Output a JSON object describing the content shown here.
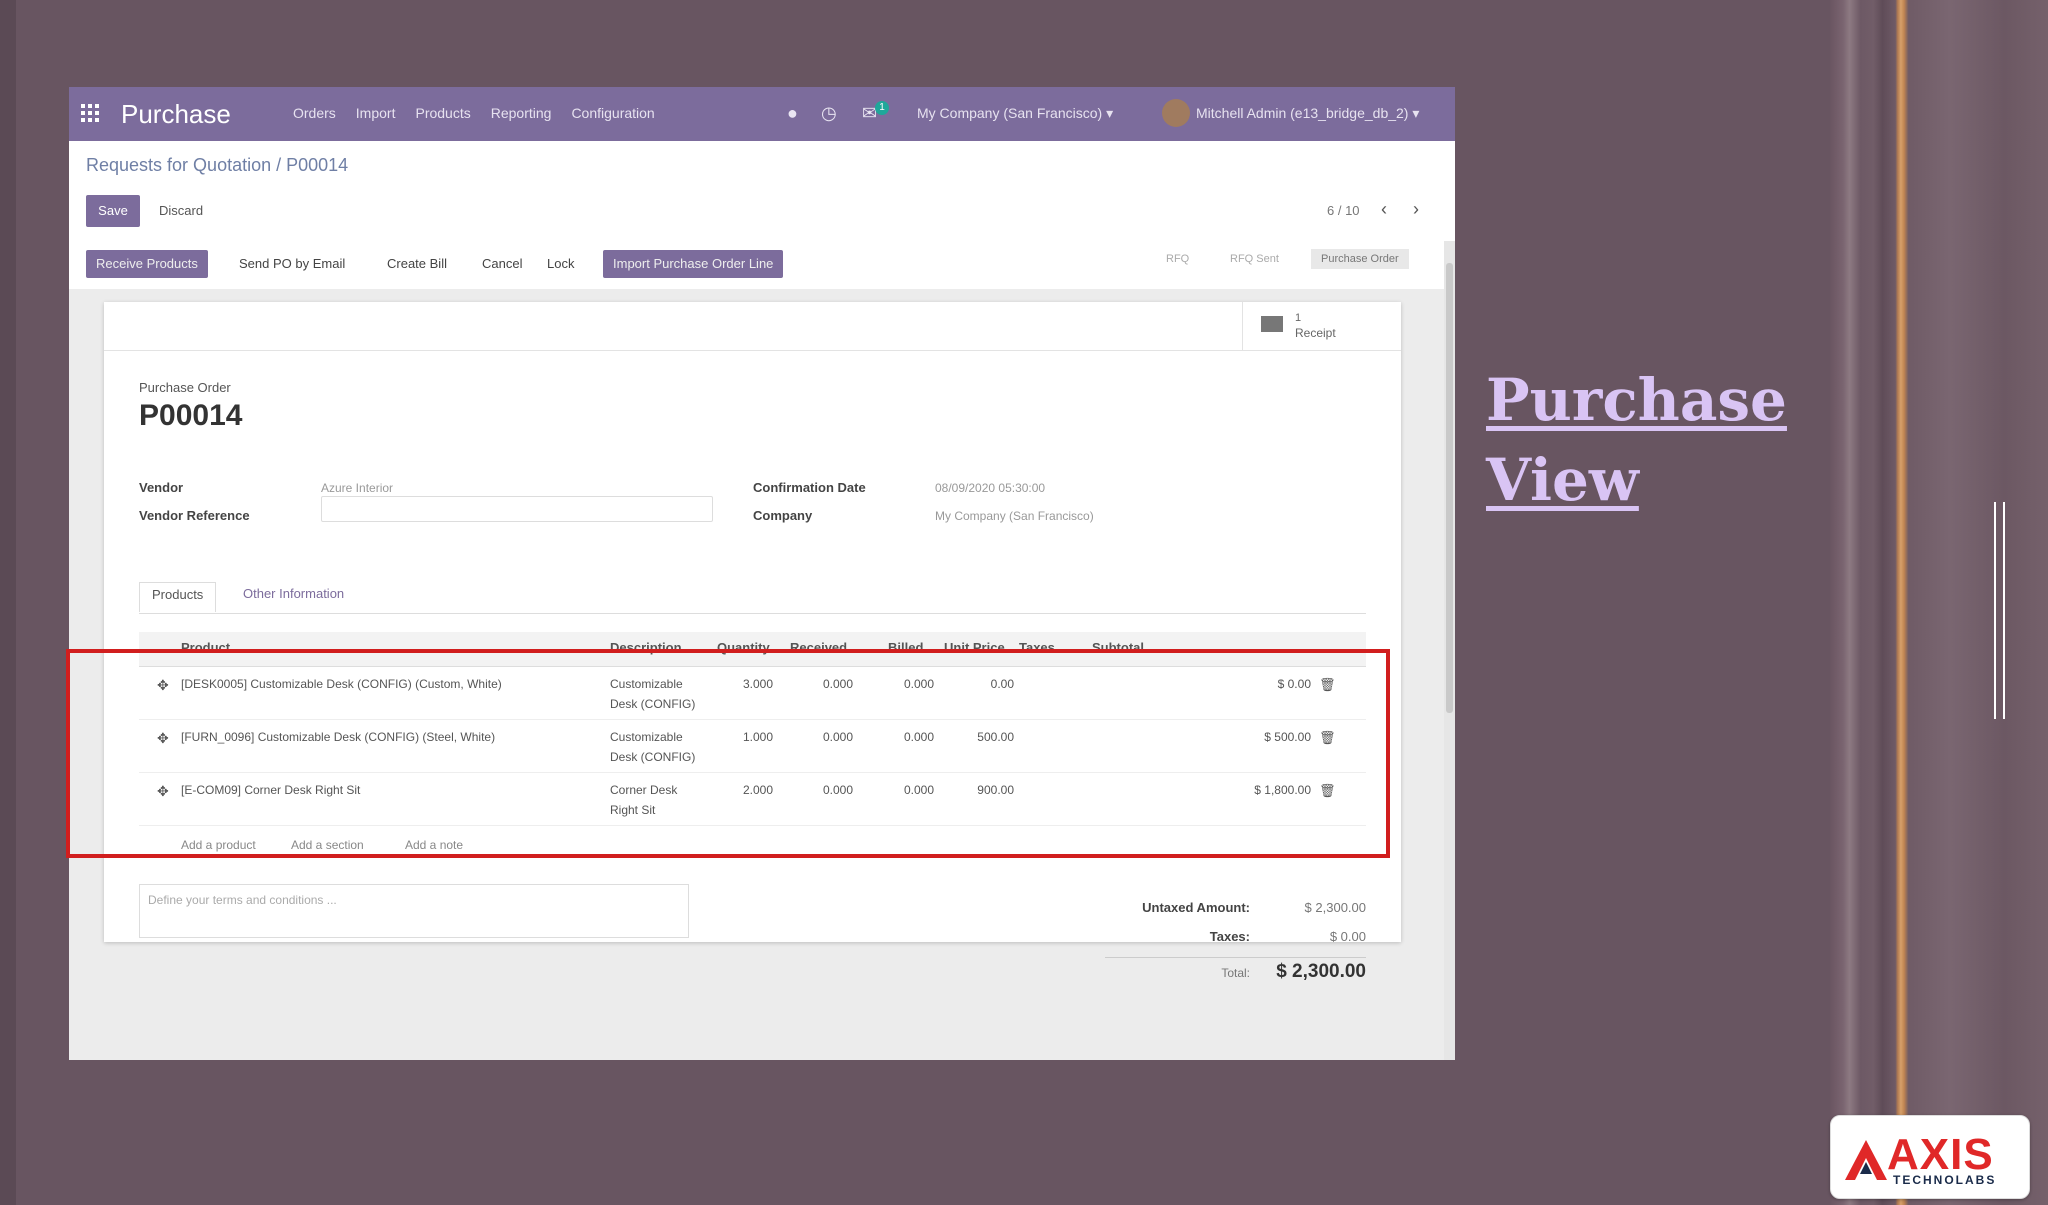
{
  "slide": {
    "title_line1": "Purchase",
    "title_line2": "View"
  },
  "logo": {
    "name": "AXIS",
    "subtitle": "TECHNOLABS"
  },
  "topbar": {
    "app_title": "Purchase",
    "menu": [
      "Orders",
      "Import",
      "Products",
      "Reporting",
      "Configuration"
    ],
    "messages_count": "1",
    "company": "My Company (San Francisco)",
    "user": "Mitchell Admin (e13_bridge_db_2)"
  },
  "control_panel": {
    "breadcrumb": "Requests for Quotation / P00014",
    "save_label": "Save",
    "discard_label": "Discard",
    "pager": "6 / 10"
  },
  "status_bar": {
    "buttons": [
      "Receive Products",
      "Send PO by Email",
      "Create Bill",
      "Cancel",
      "Lock",
      "Import Purchase Order Line"
    ],
    "stages": [
      "RFQ",
      "RFQ Sent",
      "Purchase Order"
    ]
  },
  "sheet": {
    "receipt_count": "1",
    "receipt_label": "Receipt",
    "doc_label": "Purchase Order",
    "doc_name": "P00014",
    "vendor_label": "Vendor",
    "vendor_value": "Azure Interior",
    "vendor_ref_label": "Vendor Reference",
    "confirmation_label": "Confirmation Date",
    "confirmation_value": "08/09/2020 05:30:00",
    "company_label": "Company",
    "company_value": "My Company (San Francisco)",
    "tabs": [
      "Products",
      "Other Information"
    ]
  },
  "order_lines": {
    "headers": [
      "Product",
      "Description",
      "Quantity",
      "Received",
      "Billed",
      "Unit Price",
      "Taxes",
      "Subtotal"
    ],
    "rows": [
      {
        "product": "[DESK0005] Customizable Desk (CONFIG) (Custom, White)",
        "desc1": "Customizable",
        "desc2": "Desk (CONFIG)",
        "qty": "3.000",
        "received": "0.000",
        "billed": "0.000",
        "price": "0.00",
        "subtotal": "$ 0.00"
      },
      {
        "product": "[FURN_0096] Customizable Desk (CONFIG) (Steel, White)",
        "desc1": "Customizable",
        "desc2": "Desk (CONFIG)",
        "qty": "1.000",
        "received": "0.000",
        "billed": "0.000",
        "price": "500.00",
        "subtotal": "$ 500.00"
      },
      {
        "product": "[E-COM09] Corner Desk Right Sit",
        "desc1": "Corner Desk",
        "desc2": "Right Sit",
        "qty": "2.000",
        "received": "0.000",
        "billed": "0.000",
        "price": "900.00",
        "subtotal": "$ 1,800.00"
      }
    ],
    "add_product": "Add a product",
    "add_section": "Add a section",
    "add_note": "Add a note"
  },
  "totals": {
    "terms_placeholder": "Define your terms and conditions ...",
    "untaxed_label": "Untaxed Amount:",
    "untaxed_value": "$ 2,300.00",
    "taxes_label": "Taxes:",
    "taxes_value": "$ 0.00",
    "total_label": "Total:",
    "total_value": "$ 2,300.00"
  },
  "colors": {
    "odoo_purple": "#7c6c9c",
    "highlight_red": "#d11e1e",
    "slide_bg": "#685561",
    "title_lilac": "#d9c4f4"
  }
}
